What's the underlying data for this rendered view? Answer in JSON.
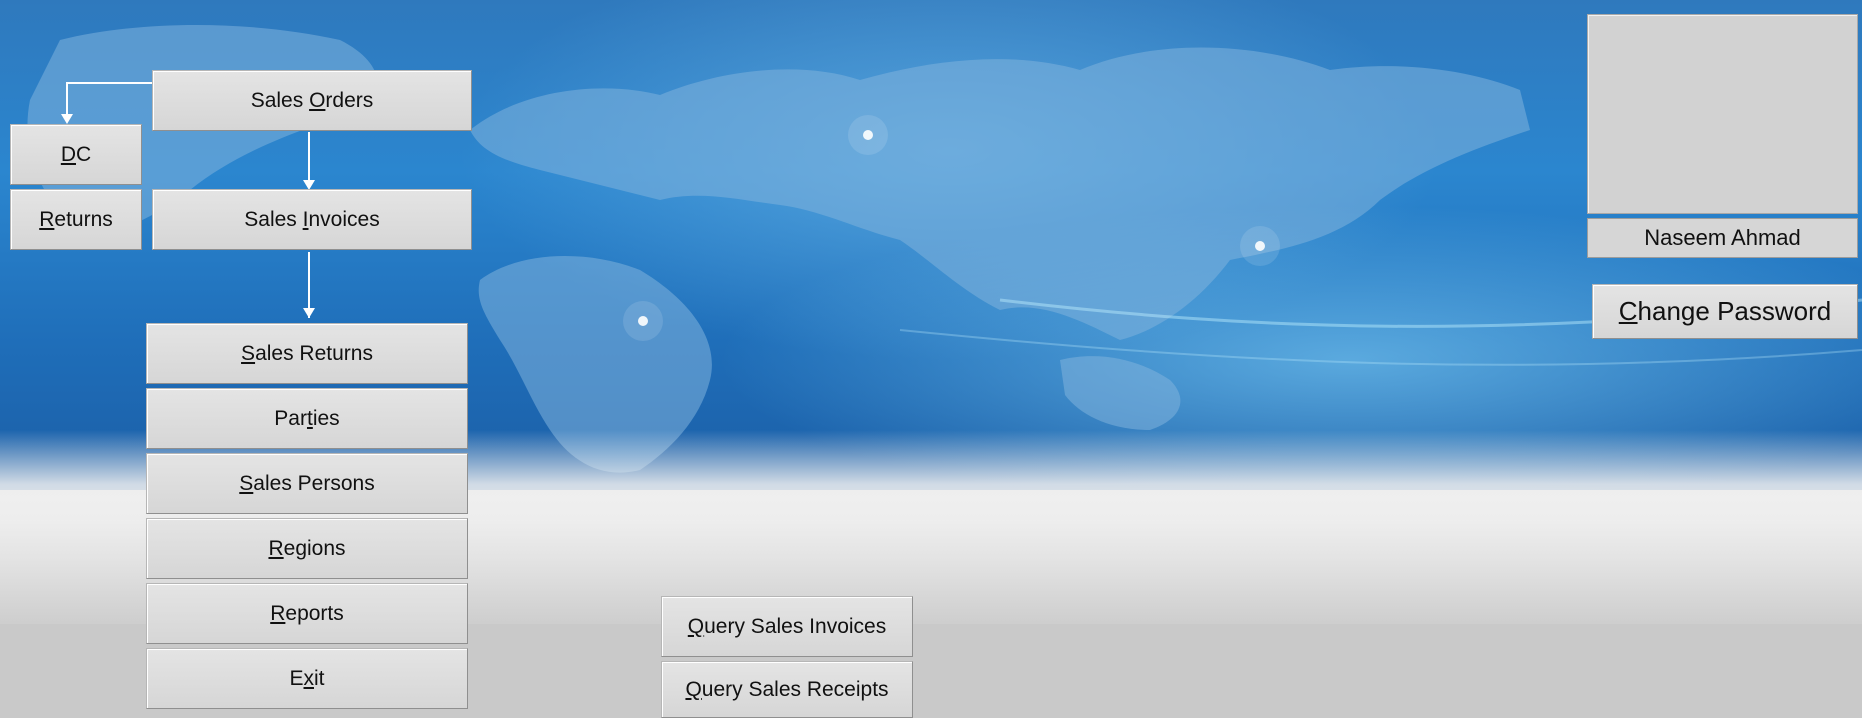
{
  "user": {
    "name": "Naseem Ahmad"
  },
  "buttons": {
    "sales_orders": {
      "pre": "Sales ",
      "key": "O",
      "post": "rders"
    },
    "dc": {
      "pre": "",
      "key": "D",
      "post": "C"
    },
    "returns": {
      "pre": "",
      "key": "R",
      "post": "eturns"
    },
    "sales_invoices": {
      "pre": "Sales ",
      "key": "I",
      "post": "nvoices"
    },
    "sales_returns": {
      "pre": "",
      "key": "S",
      "post": "ales Returns"
    },
    "parties": {
      "pre": "Par",
      "key": "t",
      "post": "ies"
    },
    "sales_persons": {
      "pre": "",
      "key": "S",
      "post": "ales Persons"
    },
    "regions": {
      "pre": "",
      "key": "R",
      "post": "egions"
    },
    "reports": {
      "pre": "",
      "key": "R",
      "post": "eports"
    },
    "exit": {
      "pre": "E",
      "key": "x",
      "post": "it"
    },
    "query_sales_invoices": {
      "pre": "",
      "key": "Q",
      "post": "uery Sales Invoices"
    },
    "query_sales_receipts": {
      "pre": "",
      "key": "Q",
      "post": "uery Sales Receipts"
    },
    "change_password": {
      "pre": "",
      "key": "C",
      "post": "hange Password"
    }
  }
}
